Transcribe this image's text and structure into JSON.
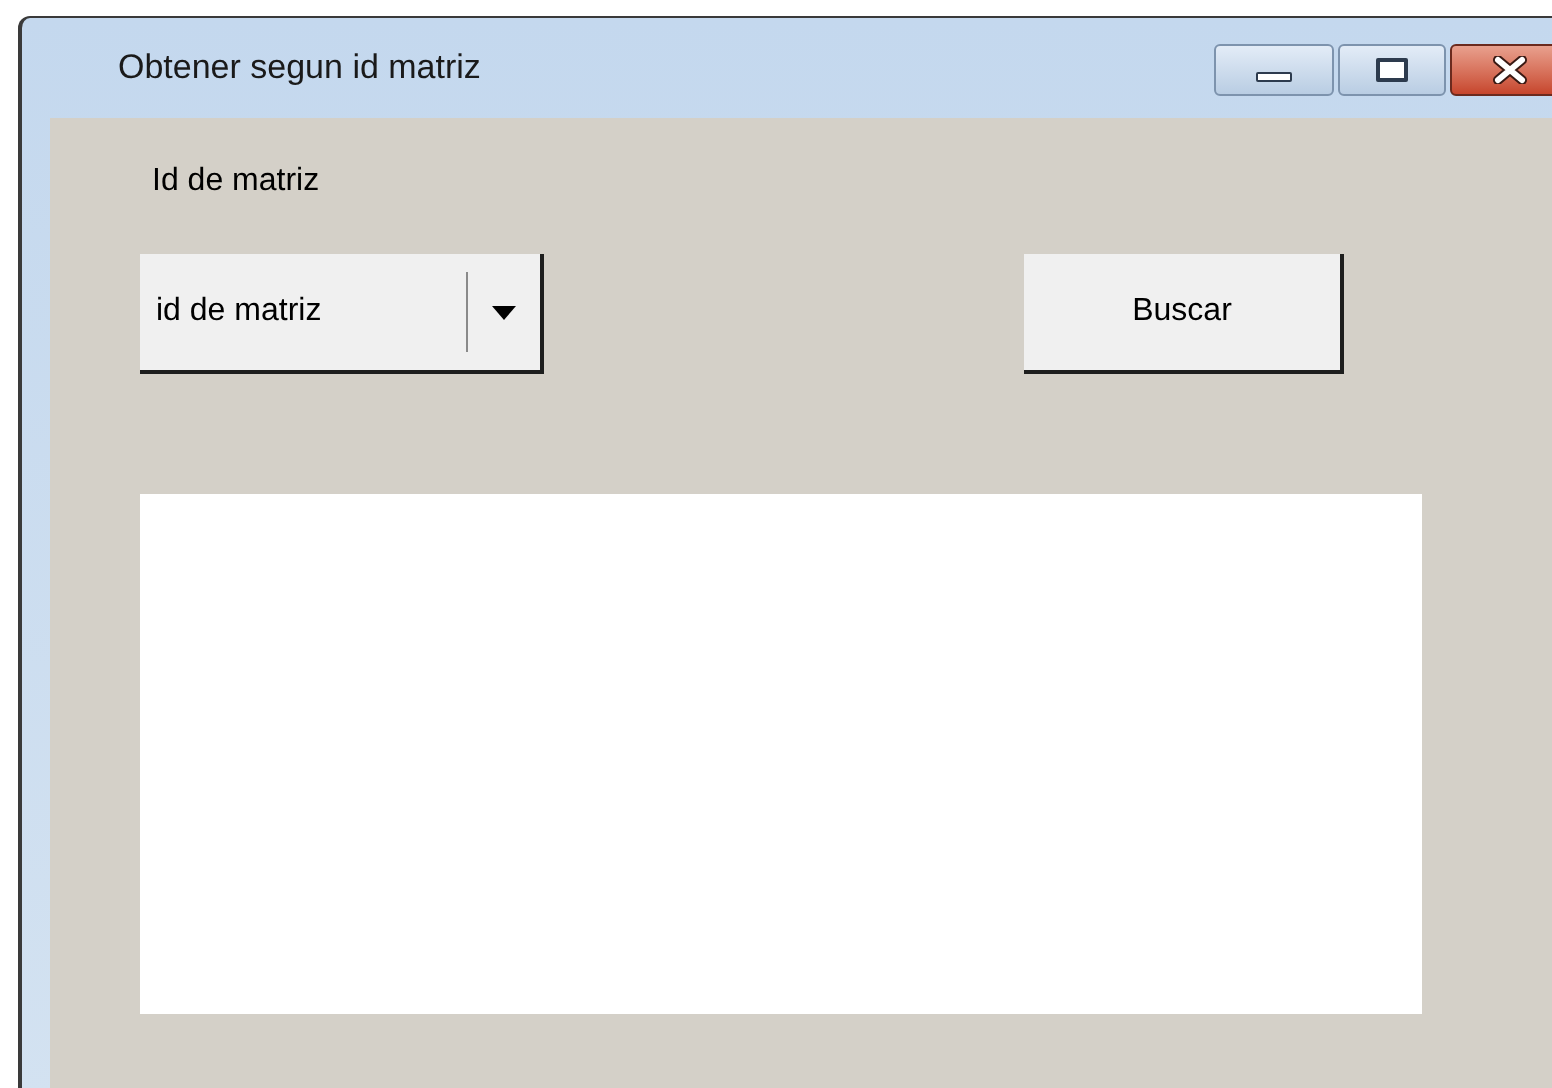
{
  "window": {
    "title": "Obtener segun id matriz"
  },
  "id_label": "Id de matriz",
  "combobox": {
    "value": "id de matriz"
  },
  "search_button": "Buscar"
}
